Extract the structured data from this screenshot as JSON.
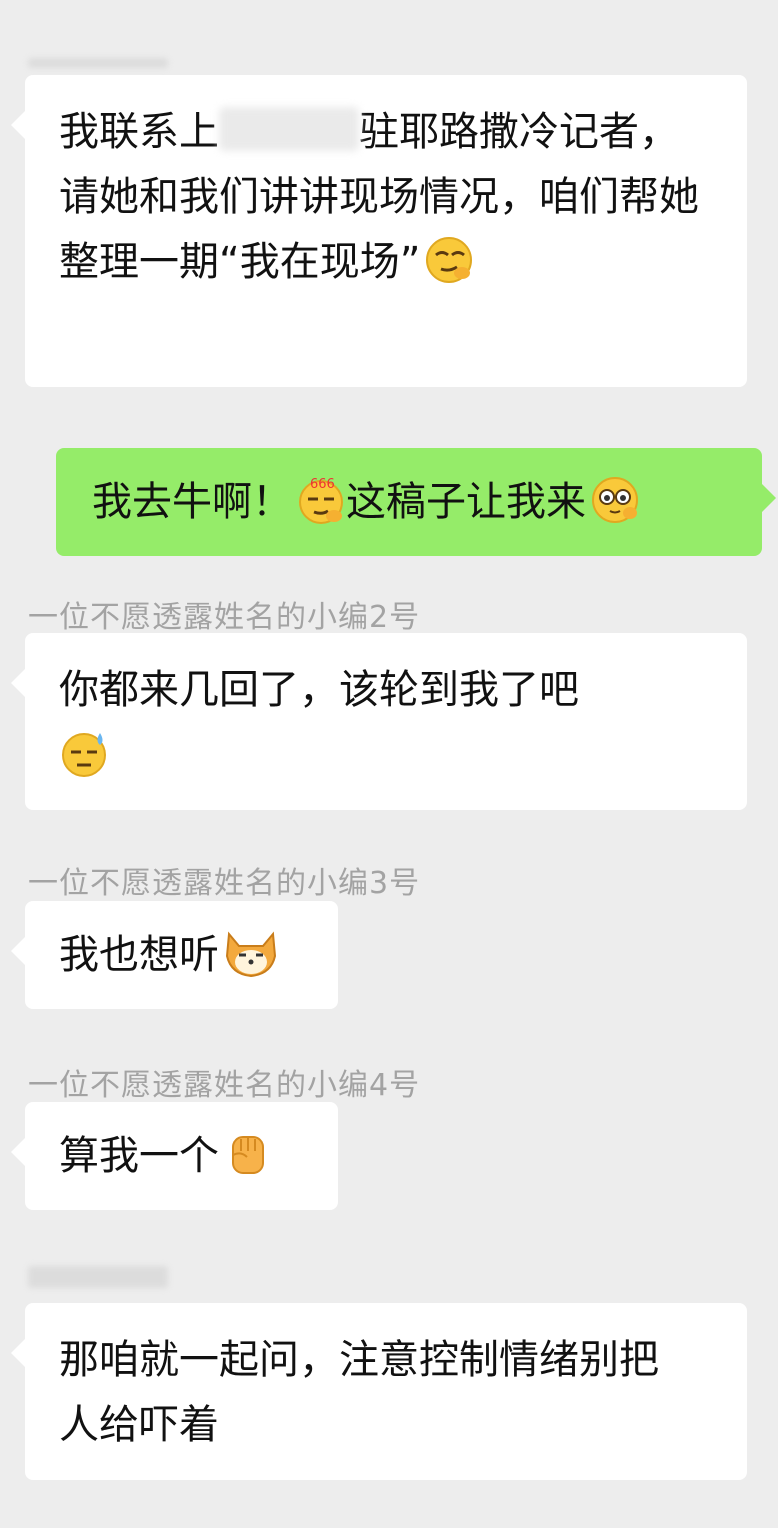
{
  "messages": [
    {
      "id": "m1",
      "direction": "incoming",
      "sender": null,
      "text_parts": [
        "我联系上",
        "驻耶路撒冷记者，请她和我们讲讲现场情况，咱们帮她整理一期“我在现场”"
      ],
      "emoji_end": "smirk-face"
    },
    {
      "id": "m2",
      "direction": "outgoing",
      "text_parts": [
        "我去牛啊！",
        "这稿子让我来"
      ],
      "emojis": [
        "666-smirk-face",
        "pleading-face"
      ]
    },
    {
      "id": "m3",
      "direction": "incoming",
      "sender": "一位不愿透露姓名的小编2号",
      "text": "你都来几回了，该轮到我了吧",
      "emoji": "sweat-face"
    },
    {
      "id": "m4",
      "direction": "incoming",
      "sender": "一位不愿透露姓名的小编3号",
      "text": "我也想听",
      "emoji": "shiba-dog"
    },
    {
      "id": "m5",
      "direction": "incoming",
      "sender": "一位不愿透露姓名的小编4号",
      "text": "算我一个",
      "emoji": "raised-fist"
    },
    {
      "id": "m6",
      "direction": "incoming",
      "sender": null,
      "text": "那咱就一起问，注意控制情绪别把人给吓着"
    }
  ],
  "colors": {
    "background": "#ededed",
    "incoming_bubble": "#ffffff",
    "outgoing_bubble": "#95ec69",
    "sender_text": "#a3a3a3"
  }
}
